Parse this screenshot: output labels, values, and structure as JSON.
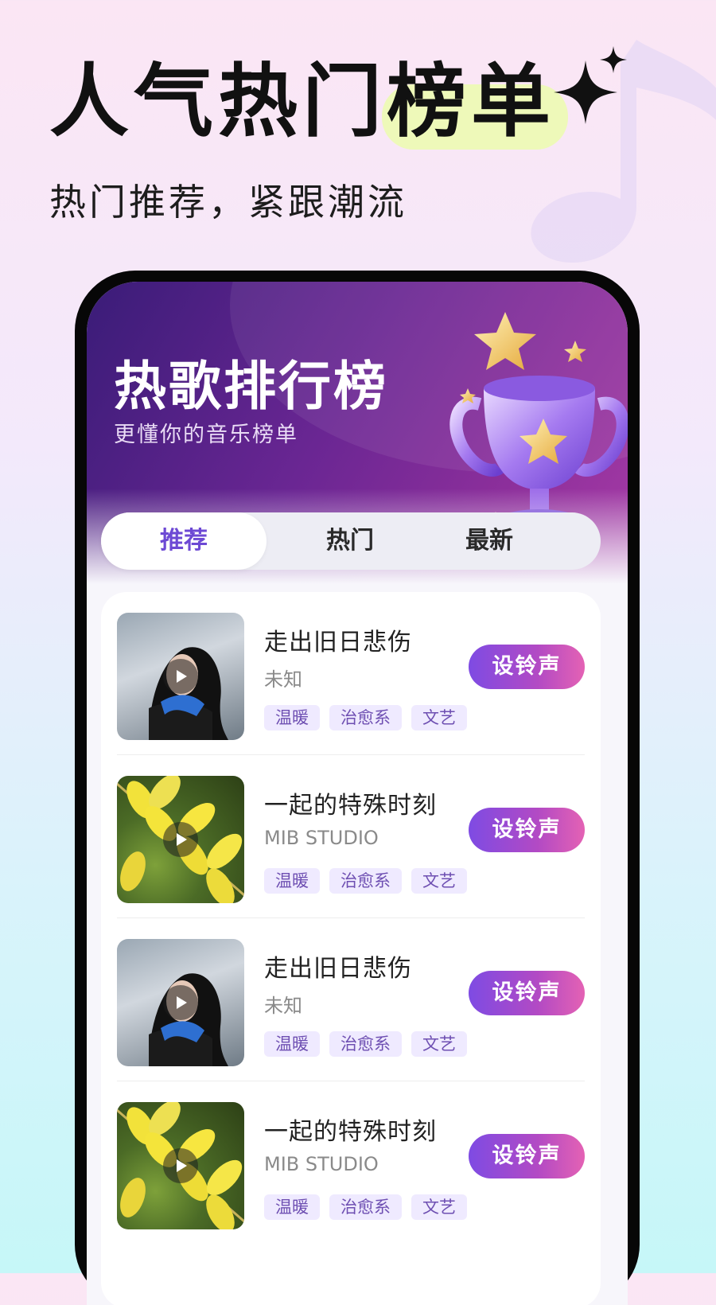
{
  "promo": {
    "headline_part1": "人气热门",
    "headline_part2": "榜单",
    "subline": "热门推荐，紧跟潮流"
  },
  "hero": {
    "title": "热歌排行榜",
    "subtitle": "更懂你的音乐榜单"
  },
  "tabs": [
    {
      "label": "推荐",
      "active": true
    },
    {
      "label": "热门",
      "active": false
    },
    {
      "label": "最新",
      "active": false
    }
  ],
  "songs": [
    {
      "title": "走出旧日悲伤",
      "artist": "未知",
      "tags": [
        "温暖",
        "治愈系",
        "文艺"
      ],
      "button": "设铃声",
      "cover": "girl-in-snow"
    },
    {
      "title": "一起的特殊时刻",
      "artist": "MIB STUDIO",
      "tags": [
        "温暖",
        "治愈系",
        "文艺"
      ],
      "button": "设铃声",
      "cover": "yellow-leaves"
    },
    {
      "title": "走出旧日悲伤",
      "artist": "未知",
      "tags": [
        "温暖",
        "治愈系",
        "文艺"
      ],
      "button": "设铃声",
      "cover": "girl-in-snow"
    },
    {
      "title": "一起的特殊时刻",
      "artist": "MIB STUDIO",
      "tags": [
        "温暖",
        "治愈系",
        "文艺"
      ],
      "button": "设铃声",
      "cover": "yellow-leaves"
    }
  ],
  "icons": {
    "play": "play-icon",
    "trophy": "trophy-icon",
    "note": "music-note-icon",
    "sparkle": "sparkle-icon"
  },
  "colors": {
    "accent": "#6d49d4",
    "button_start": "#7e4be3",
    "button_end": "#e462b4",
    "tag_bg": "#efeaff"
  }
}
